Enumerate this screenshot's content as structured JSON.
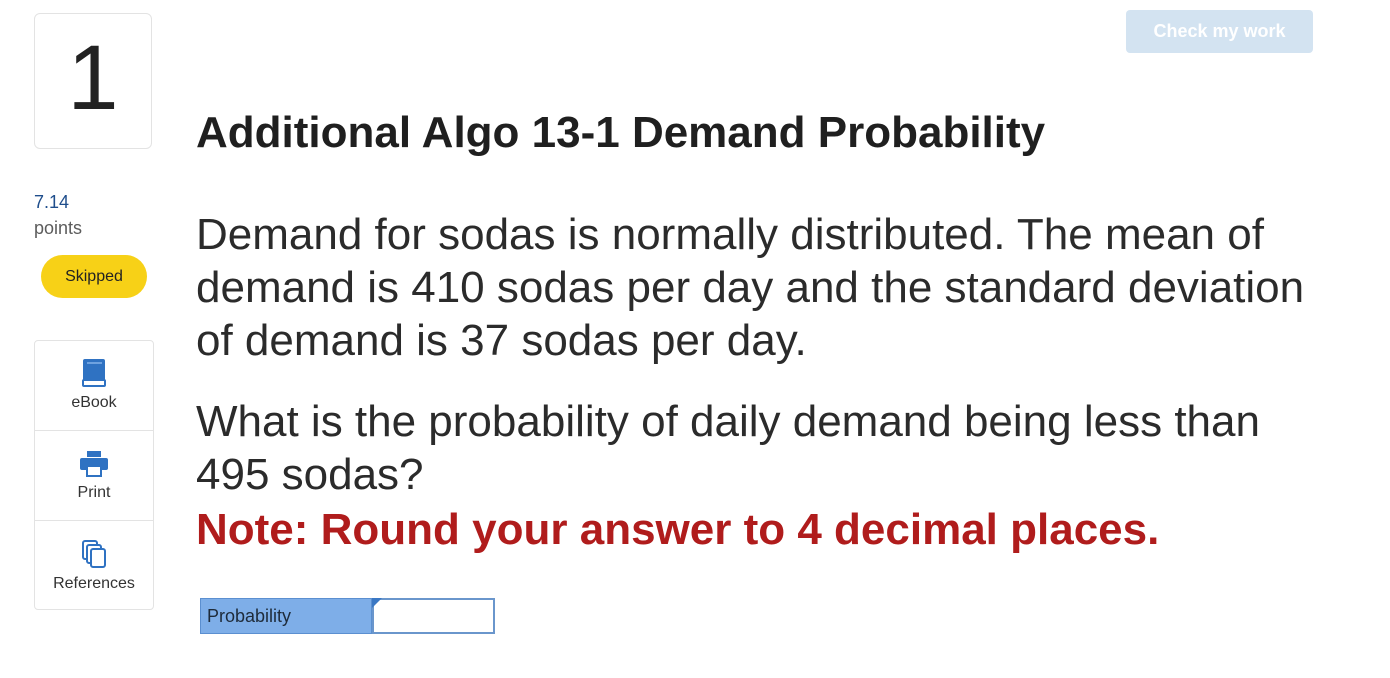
{
  "question": {
    "number": "1",
    "points_value": "7.14",
    "points_label": "points",
    "status": "Skipped"
  },
  "tools": [
    {
      "label": "eBook",
      "icon": "book-icon"
    },
    {
      "label": "Print",
      "icon": "printer-icon"
    },
    {
      "label": "References",
      "icon": "copy-icon"
    }
  ],
  "header": {
    "check_label": "Check my work"
  },
  "content": {
    "title": "Additional Algo 13-1 Demand Probability",
    "paragraph1": "Demand for sodas is normally distributed. The mean of demand is 410 sodas per day and the standard deviation of demand is 37 sodas per day.",
    "paragraph2": "What is the probability of daily demand being less than 495 sodas?",
    "note": "Note: Round your answer to 4 decimal places."
  },
  "answer": {
    "label": "Probability",
    "value": "",
    "placeholder": ""
  },
  "colors": {
    "accent": "#1f4e8c",
    "skipped_badge": "#f7d117",
    "note_red": "#b01c1c",
    "check_button_disabled": "#d3e3f1",
    "answer_label_bg": "#7eaee8"
  }
}
